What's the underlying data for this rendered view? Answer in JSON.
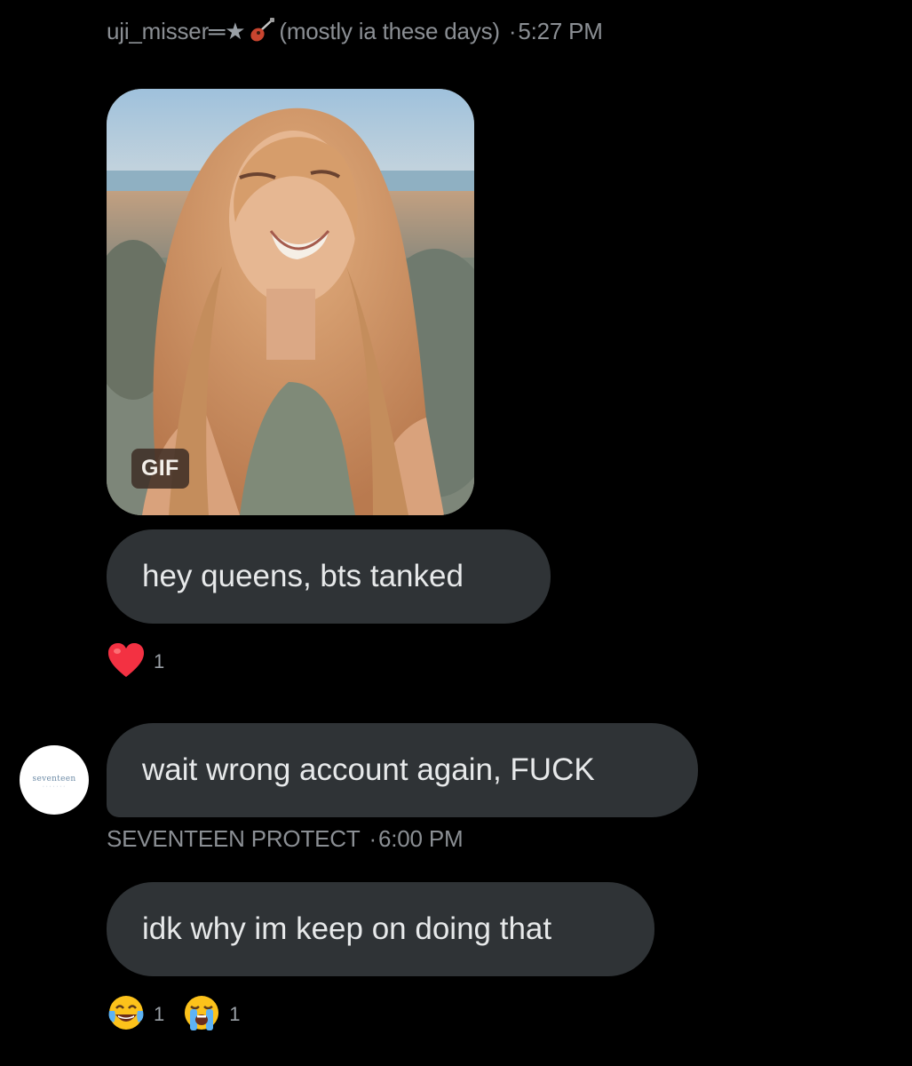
{
  "messages": [
    {
      "sender": "uji_misser",
      "sender_decor": "═★",
      "sender_note": "(mostly ia these days)",
      "time": "5:27 PM",
      "gif_badge": "GIF",
      "text": "hey queens, bts tanked",
      "reactions": [
        {
          "icon": "red-heart-emoji-icon",
          "count": "1"
        }
      ]
    },
    {
      "text": "wait wrong account again, FUCK",
      "avatar_logo": "seventeen",
      "sender": "SEVENTEEN PROTECT",
      "time": "6:00 PM"
    },
    {
      "text": "idk why im keep on doing that",
      "reactions": [
        {
          "icon": "face-with-tears-of-joy-emoji-icon",
          "count": "1"
        },
        {
          "icon": "loudly-crying-face-emoji-icon",
          "count": "1"
        }
      ]
    }
  ],
  "separator": "·",
  "colors": {
    "background": "#000000",
    "bubble": "#2f3336",
    "text": "#e7e9ea",
    "meta_text": "#8b8f94",
    "heart": "#e0245e"
  }
}
